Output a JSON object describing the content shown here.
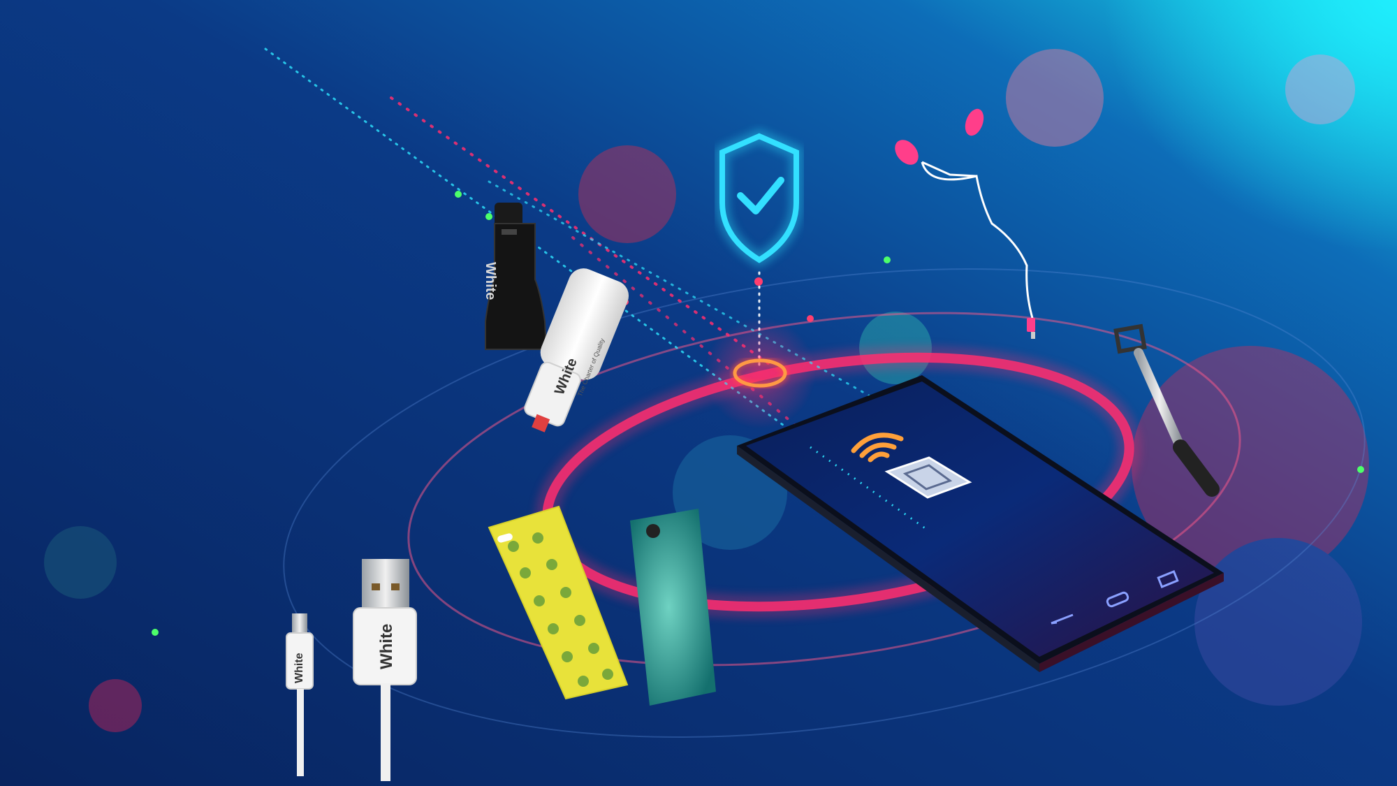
{
  "scene": {
    "brand": "White",
    "charter_tagline": "The Charter of Quality",
    "cable_brand_small": "White",
    "cable_brand_large": "White",
    "charger_black_brand": "White",
    "charger_white_brand": "White"
  },
  "colors": {
    "bg_dark": "#08245f",
    "bg_mid": "#0d3d8a",
    "bg_light": "#16c9e6",
    "neon_pink": "#ff2e6e",
    "neon_cyan": "#2ee6ff",
    "neon_green": "#4dff6a",
    "shield": "#33e0ff",
    "case_yellow": "#e8e23a",
    "case_teal": "#1f8a84",
    "earphone_pink": "#ff3e8a"
  },
  "icons": [
    "shield-check-icon",
    "wifi-signal-icon",
    "sim-chip-icon",
    "back-icon",
    "home-icon",
    "recent-apps-icon"
  ]
}
